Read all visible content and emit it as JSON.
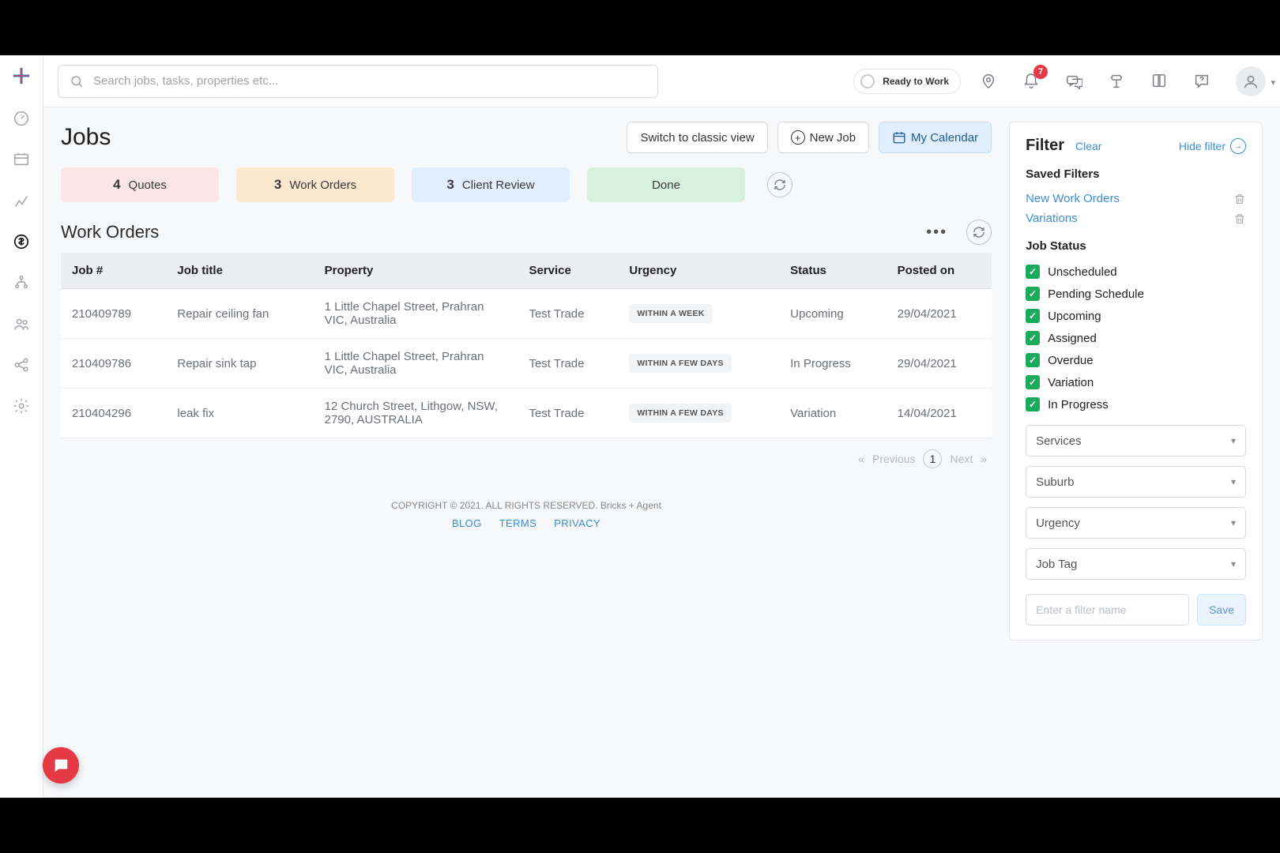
{
  "search": {
    "placeholder": "Search jobs, tasks, properties etc..."
  },
  "topbar": {
    "ready_label": "Ready to Work",
    "notif_count": "7"
  },
  "page": {
    "title": "Jobs",
    "switch_classic": "Switch to classic view",
    "new_job": "New Job",
    "my_calendar": "My Calendar"
  },
  "tabs": {
    "quotes": {
      "count": "4",
      "label": "Quotes"
    },
    "workorders": {
      "count": "3",
      "label": "Work Orders"
    },
    "client": {
      "count": "3",
      "label": "Client Review"
    },
    "done": {
      "label": "Done"
    }
  },
  "section": {
    "title": "Work Orders"
  },
  "columns": {
    "job_no": "Job #",
    "title": "Job title",
    "property": "Property",
    "service": "Service",
    "urgency": "Urgency",
    "status": "Status",
    "posted": "Posted on"
  },
  "rows": [
    {
      "job_no": "210409789",
      "title": "Repair ceiling fan",
      "property": "1 Little Chapel Street, Prahran VIC, Australia",
      "service": "Test Trade",
      "urgency": "WITHIN A WEEK",
      "status": "Upcoming",
      "posted": "29/04/2021"
    },
    {
      "job_no": "210409786",
      "title": "Repair sink tap",
      "property": "1 Little Chapel Street, Prahran VIC, Australia",
      "service": "Test Trade",
      "urgency": "WITHIN A FEW DAYS",
      "status": "In Progress",
      "posted": "29/04/2021"
    },
    {
      "job_no": "210404296",
      "title": "leak fix",
      "property": "12 Church Street, Lithgow, NSW, 2790, AUSTRALIA",
      "service": "Test Trade",
      "urgency": "WITHIN A FEW DAYS",
      "status": "Variation",
      "posted": "14/04/2021"
    }
  ],
  "pager": {
    "prev": "Previous",
    "page": "1",
    "next": "Next"
  },
  "filter": {
    "title": "Filter",
    "clear": "Clear",
    "hide": "Hide filter",
    "saved_h": "Saved Filters",
    "saved": [
      {
        "label": "New Work Orders"
      },
      {
        "label": "Variations"
      }
    ],
    "status_h": "Job Status",
    "statuses": [
      "Unscheduled",
      "Pending Schedule",
      "Upcoming",
      "Assigned",
      "Overdue",
      "Variation",
      "In Progress"
    ],
    "dd_services": "Services",
    "dd_suburb": "Suburb",
    "dd_urgency": "Urgency",
    "dd_jobtag": "Job Tag",
    "name_ph": "Enter a filter name",
    "save": "Save"
  },
  "footer": {
    "copy": "COPYRIGHT © 2021. ALL RIGHTS RESERVED. Bricks + Agent",
    "blog": "BLOG",
    "terms": "TERMS",
    "privacy": "PRIVACY"
  }
}
